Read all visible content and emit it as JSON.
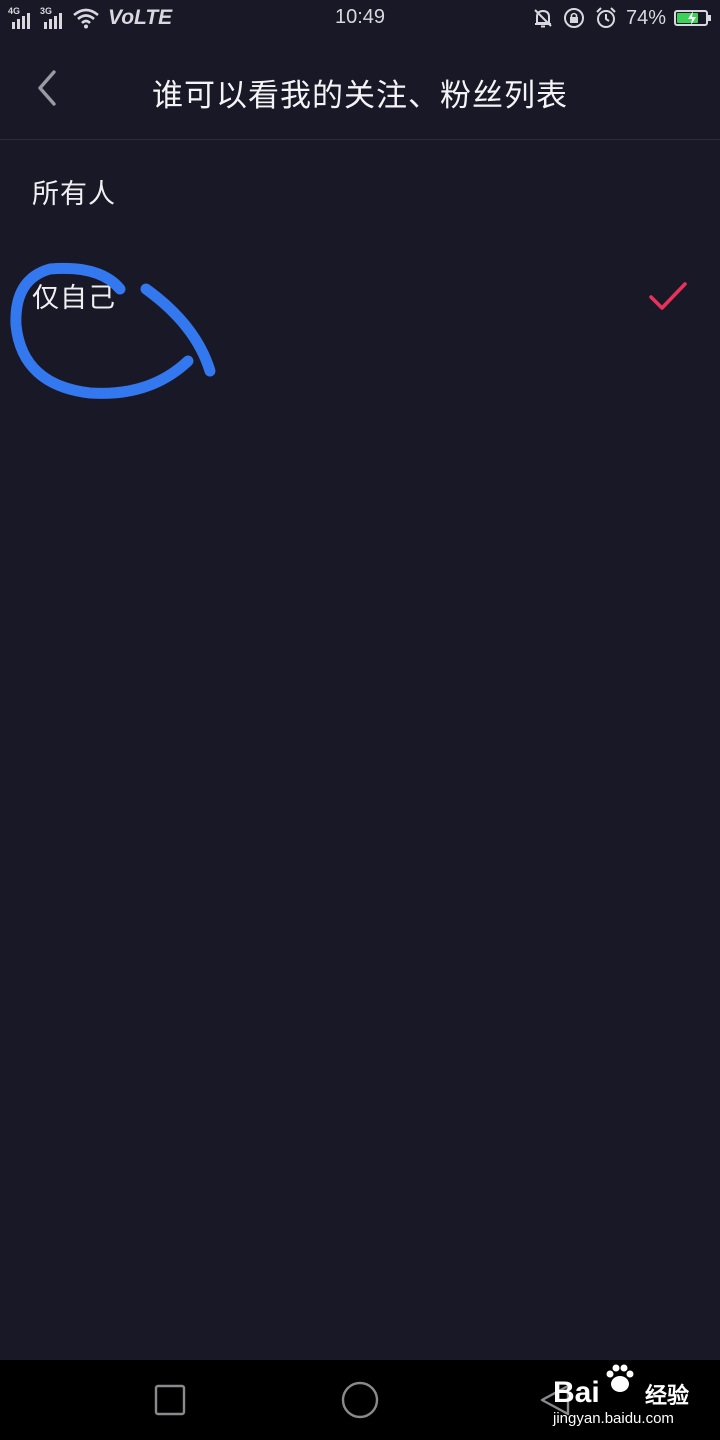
{
  "status_bar": {
    "sim1_type": "4G",
    "sim2_type": "3G",
    "volte": "VoLTE",
    "time": "10:49",
    "battery_percent": "74%",
    "battery_level": 0.74,
    "battery_fill_color": "#3cd25a",
    "icons": [
      "signal-icon",
      "wifi-icon",
      "mute-icon",
      "rotation-lock-icon",
      "alarm-icon",
      "battery-icon"
    ]
  },
  "header": {
    "title": "谁可以看我的关注、粉丝列表",
    "back_icon": "chevron-left-icon"
  },
  "options": [
    {
      "label": "所有人",
      "selected": false
    },
    {
      "label": "仅自己",
      "selected": true
    }
  ],
  "colors": {
    "background": "#181826",
    "check": "#e8325a",
    "annotation": "#3478f0"
  },
  "nav_bar": {
    "icons": [
      "recent-apps-icon",
      "home-icon",
      "back-icon"
    ]
  },
  "watermark": {
    "logo": "Bai",
    "text": "经验",
    "url": "jingyan.baidu.com"
  }
}
